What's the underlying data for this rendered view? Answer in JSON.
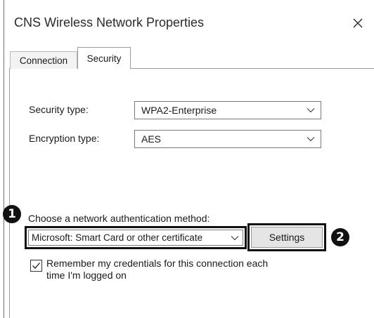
{
  "window": {
    "title": "CNS Wireless Network Properties"
  },
  "tabs": [
    {
      "label": "Connection",
      "selected": false
    },
    {
      "label": "Security",
      "selected": true
    }
  ],
  "security": {
    "security_type_label": "Security type:",
    "security_type_value": "WPA2-Enterprise",
    "encryption_type_label": "Encryption type:",
    "encryption_type_value": "AES",
    "auth_method_label": "Choose a network authentication method:",
    "auth_method_value": "Microsoft: Smart Card or other certificate",
    "settings_label": "Settings",
    "remember_checked": true,
    "remember_line1": "Remember my credentials for this connection each",
    "remember_line2": "time I'm logged on"
  },
  "callouts": {
    "one": "1",
    "two": "2"
  },
  "icons": {
    "close": "close-icon",
    "dropdown": "chevron-down-icon",
    "check": "checkmark-icon"
  }
}
